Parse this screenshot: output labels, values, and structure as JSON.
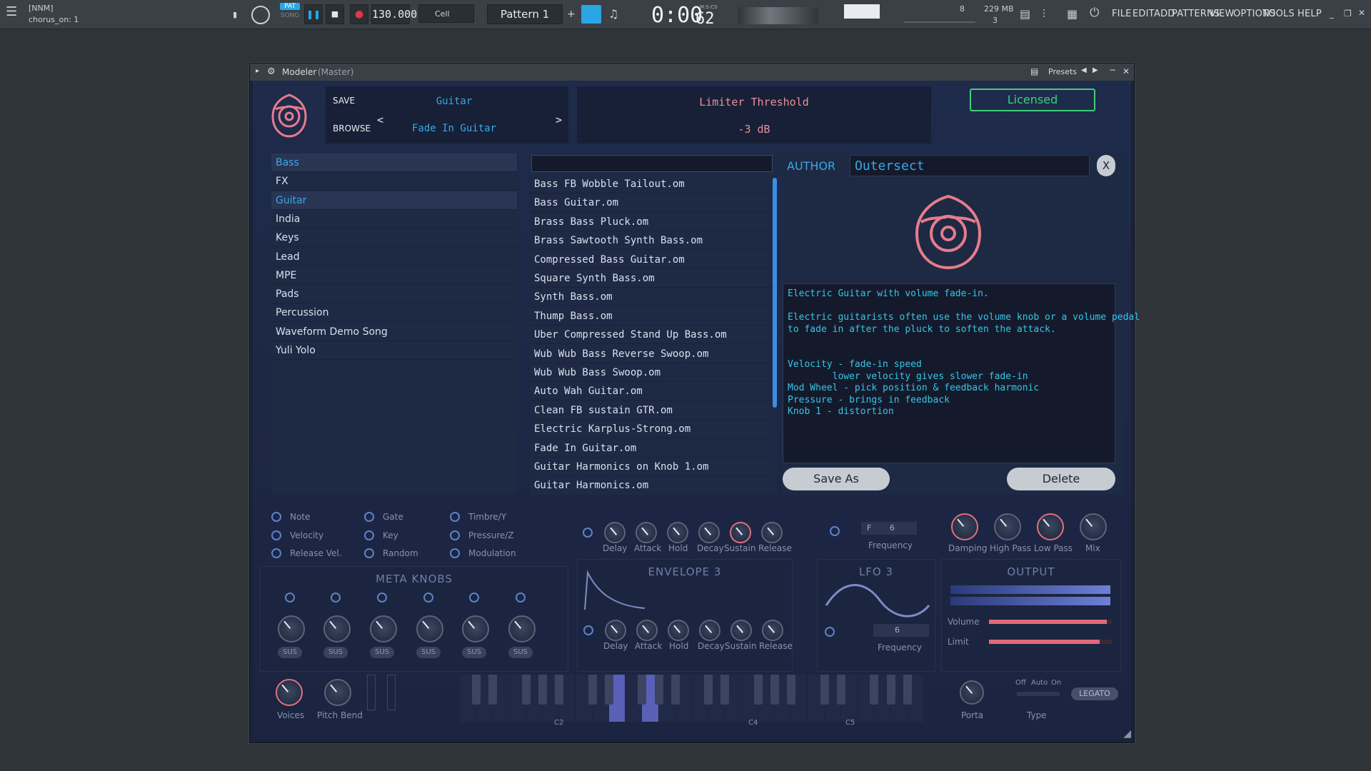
{
  "topbar": {
    "project": "[NNM]",
    "hint": "chorus_on: 1",
    "pat_label": "PAT",
    "song_label": "SONG",
    "tempo": "130.000",
    "snap": "Cell",
    "pattern": "Pattern 1",
    "time": "0:00",
    "time_small": "62",
    "time_unit": "M:S:CS",
    "cpu": "8",
    "memory": "229 MB",
    "poly": "3",
    "menus": [
      "FILE",
      "EDIT",
      "ADD",
      "PATTERNS",
      "VIEW",
      "OPTIONS",
      "TOOLS",
      "HELP"
    ]
  },
  "window": {
    "title": "Modeler",
    "title_suffix": "(Master)",
    "presets_label": "Presets"
  },
  "header": {
    "save": "SAVE",
    "browse": "BROWSE",
    "category": "Guitar",
    "preset": "Fade In Guitar",
    "prev": "<",
    "next": ">",
    "param_name": "Limiter Threshold",
    "param_value": "-3 dB",
    "licensed": "Licensed"
  },
  "categories": [
    {
      "label": "Bass",
      "selected": true
    },
    {
      "label": "FX"
    },
    {
      "label": "Guitar",
      "highlight": true
    },
    {
      "label": "India"
    },
    {
      "label": "Keys"
    },
    {
      "label": "Lead"
    },
    {
      "label": "MPE"
    },
    {
      "label": "Pads"
    },
    {
      "label": "Percussion"
    },
    {
      "label": "Waveform Demo Song"
    },
    {
      "label": "Yuli Yolo"
    }
  ],
  "search": {
    "placeholder": ""
  },
  "files": [
    "Bass FB Wobble Tailout.om",
    "Bass Guitar.om",
    "Brass Bass Pluck.om",
    "Brass Sawtooth Synth Bass.om",
    "Compressed Bass Guitar.om",
    "Square Synth Bass.om",
    "Synth Bass.om",
    "Thump Bass.om",
    "Uber Compressed Stand Up Bass.om",
    "Wub Wub Bass Reverse Swoop.om",
    "Wub Wub Bass Swoop.om",
    "Auto Wah Guitar.om",
    "Clean FB sustain GTR.om",
    "Electric Karplus-Strong.om",
    "Fade In Guitar.om",
    "Guitar Harmonics on Knob 1.om",
    "Guitar Harmonics.om"
  ],
  "details": {
    "author_label": "AUTHOR",
    "author": "Outersect",
    "close": "X",
    "desc_lines": [
      "Electric Guitar with volume fade-in.",
      "",
      "Electric guitarists often use the volume knob or a volume pedal",
      "to fade in after the pluck to soften the attack.",
      "",
      "",
      "Velocity - fade-in speed",
      "        lower velocity gives slower fade-in",
      "Mod Wheel - pick position & feedback harmonic",
      "Pressure - brings in feedback",
      "Knob 1 - distortion"
    ],
    "save_as": "Save As",
    "delete": "Delete"
  },
  "synth": {
    "mod_sources": [
      "Note",
      "Velocity",
      "Release Vel.",
      "Gate",
      "Key",
      "Random",
      "Timbre/Y",
      "Pressure/Z",
      "Modulation"
    ],
    "meta_knobs_title": "META KNOBS",
    "sus": "SUS",
    "env_labels": [
      "Delay",
      "Attack",
      "Hold",
      "Decay",
      "Sustain",
      "Release"
    ],
    "envelope3_title": "ENVELOPE 3",
    "lfo3_title": "LFO 3",
    "frequency": "Frequency",
    "lfo_rate_1": "6",
    "lfo_rate_2": "6",
    "lfo_note": "F",
    "output_knobs": [
      "Damping",
      "High Pass",
      "Low Pass",
      "Mix"
    ],
    "output_title": "OUTPUT",
    "volume": "Volume",
    "limit": "Limit",
    "volume_level": 0.96,
    "limit_level": 0.9,
    "voices": "Voices",
    "pitch_bend": "Pitch Bend",
    "octave_labels": [
      "C2",
      "C4",
      "C5"
    ],
    "porta": "Porta",
    "type": "Type",
    "mode_labels": [
      "Off",
      "Auto",
      "On"
    ],
    "legato": "LEGATO"
  },
  "colors": {
    "accent": "#3aa7e8",
    "licensed": "#3fd07a",
    "pink": "#e67c8c",
    "bg": "#1b2440"
  }
}
